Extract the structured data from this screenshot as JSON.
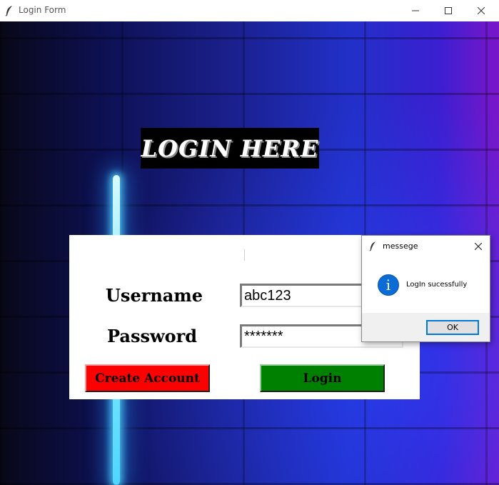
{
  "window": {
    "title": "Login Form",
    "controls": [
      "minimize-icon",
      "maximize-icon",
      "close-icon"
    ]
  },
  "form": {
    "heading": "LOGIN HERE",
    "username_label": "Username",
    "username_value": "abc123",
    "password_label": "Password",
    "password_value": "*******",
    "create_account_label": "Create Account",
    "login_label": "Login"
  },
  "dialog": {
    "title": "messege",
    "message": "LogIn sucessfully",
    "ok_label": "OK",
    "icon": "info-icon"
  },
  "colors": {
    "create_button": "#ff0000",
    "login_button": "#008000",
    "info_icon": "#0b6cd6"
  }
}
